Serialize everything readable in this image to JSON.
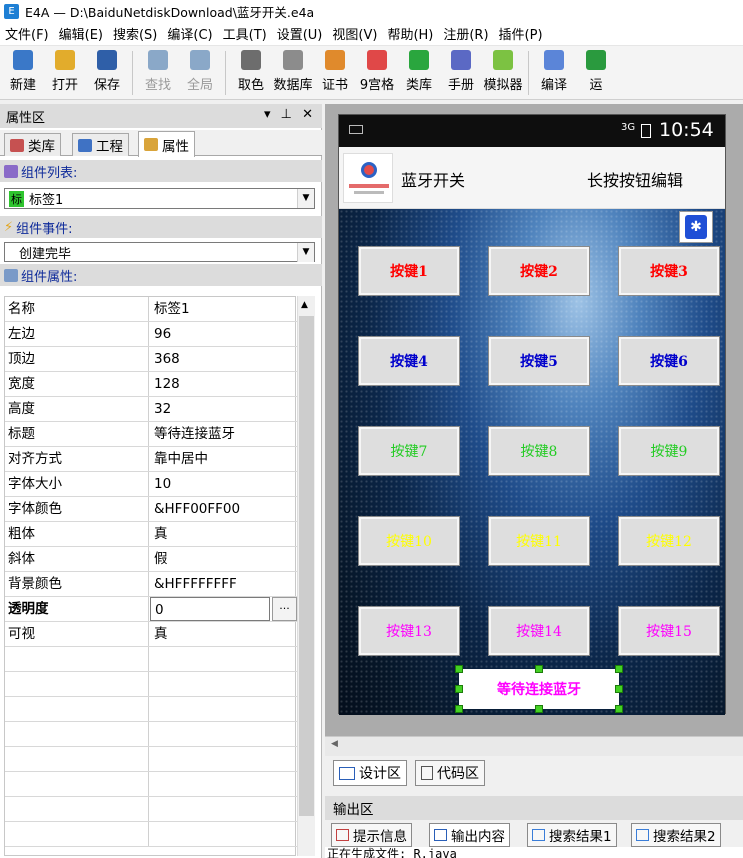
{
  "window": {
    "title": "E4A — D:\\BaiduNetdiskDownload\\蓝牙开关.e4a",
    "app_icon_text": "E"
  },
  "menu": [
    "文件(F)",
    "编辑(E)",
    "搜索(S)",
    "编译(C)",
    "工具(T)",
    "设置(U)",
    "视图(V)",
    "帮助(H)",
    "注册(R)",
    "插件(P)"
  ],
  "toolbar": [
    {
      "label": "新建",
      "icon": "new-file-icon",
      "color": "#3a78c8",
      "disabled": false
    },
    {
      "label": "打开",
      "icon": "folder-open-icon",
      "color": "#e2ac2c",
      "disabled": false
    },
    {
      "label": "保存",
      "icon": "save-disk-icon",
      "color": "#2f5fa8",
      "disabled": false
    },
    {
      "label": "查找",
      "icon": "magnifier-icon",
      "color": "#8aa8c8",
      "disabled": true
    },
    {
      "label": "全局",
      "icon": "global-search-icon",
      "color": "#8aa8c8",
      "disabled": true
    },
    {
      "label": "取色",
      "icon": "eyedropper-icon",
      "color": "#6d6d6d",
      "disabled": false
    },
    {
      "label": "数据库",
      "icon": "database-icon",
      "color": "#8c8c8c",
      "disabled": false
    },
    {
      "label": "证书",
      "icon": "certificate-icon",
      "color": "#e08a2c",
      "disabled": false
    },
    {
      "label": "9宫格",
      "icon": "grid-icon",
      "color": "#e04848",
      "disabled": false
    },
    {
      "label": "类库",
      "icon": "library-icon",
      "color": "#2aa63e",
      "disabled": false
    },
    {
      "label": "手册",
      "icon": "manual-icon",
      "color": "#5b69c4",
      "disabled": false
    },
    {
      "label": "模拟器",
      "icon": "android-icon",
      "color": "#7cc242",
      "disabled": false
    },
    {
      "label": "编译",
      "icon": "compile-icon",
      "color": "#5b85d8",
      "disabled": false
    },
    {
      "label": "运",
      "icon": "run-icon",
      "color": "#2a9a3e",
      "disabled": false
    }
  ],
  "left_panel": {
    "title": "属性区",
    "title_controls": "▾ ⊥ ✕",
    "tabs": [
      "类库",
      "工程",
      "属性"
    ],
    "component_list_label": "组件列表:",
    "component_selected_badge": "标",
    "component_selected": "标签1",
    "component_events_label": "组件事件:",
    "event_selected": "创建完毕",
    "component_props_label": "组件属性:",
    "properties": [
      {
        "name": "名称",
        "value": "标签1"
      },
      {
        "name": "左边",
        "value": "96"
      },
      {
        "name": "顶边",
        "value": "368"
      },
      {
        "name": "宽度",
        "value": "128"
      },
      {
        "name": "高度",
        "value": "32"
      },
      {
        "name": "标题",
        "value": "等待连接蓝牙"
      },
      {
        "name": "对齐方式",
        "value": "靠中居中"
      },
      {
        "name": "字体大小",
        "value": "10"
      },
      {
        "name": "字体颜色",
        "value": "&HFF00FF00"
      },
      {
        "name": "粗体",
        "value": "真"
      },
      {
        "name": "斜体",
        "value": "假"
      },
      {
        "name": "背景颜色",
        "value": "&HFFFFFFFF"
      },
      {
        "name": "透明度",
        "value": "0"
      },
      {
        "name": "可视",
        "value": "真"
      }
    ],
    "ellipsis": "···"
  },
  "phone": {
    "status_sig": "3G",
    "time": "10:54",
    "app_title": "蓝牙开关",
    "hint": "长按按钮编辑",
    "bt_glyph": "✱",
    "buttons": [
      {
        "label": "按键1",
        "color": "#ff0000",
        "bold": true
      },
      {
        "label": "按键2",
        "color": "#ff0000",
        "bold": true
      },
      {
        "label": "按键3",
        "color": "#ff0000",
        "bold": true
      },
      {
        "label": "按键4",
        "color": "#0000cc",
        "bold": true
      },
      {
        "label": "按键5",
        "color": "#0000cc",
        "bold": true
      },
      {
        "label": "按键6",
        "color": "#0000cc",
        "bold": true
      },
      {
        "label": "按键7",
        "color": "#22cc22",
        "bold": false
      },
      {
        "label": "按键8",
        "color": "#22cc22",
        "bold": false
      },
      {
        "label": "按键9",
        "color": "#22cc22",
        "bold": false
      },
      {
        "label": "按键10",
        "color": "#ffff00",
        "bold": false
      },
      {
        "label": "按键11",
        "color": "#ffff00",
        "bold": false
      },
      {
        "label": "按键12",
        "color": "#ffff00",
        "bold": false
      },
      {
        "label": "按键13",
        "color": "#ff00ff",
        "bold": false
      },
      {
        "label": "按键14",
        "color": "#ff00ff",
        "bold": false
      },
      {
        "label": "按键15",
        "color": "#ff00ff",
        "bold": false
      }
    ],
    "status_label": "等待连接蓝牙"
  },
  "design_tabs": [
    "设计区",
    "代码区"
  ],
  "output": {
    "title": "输出区",
    "tabs": [
      "提示信息",
      "输出内容",
      "搜索结果1",
      "搜索结果2"
    ],
    "text": "正在生成文件: R.java"
  }
}
